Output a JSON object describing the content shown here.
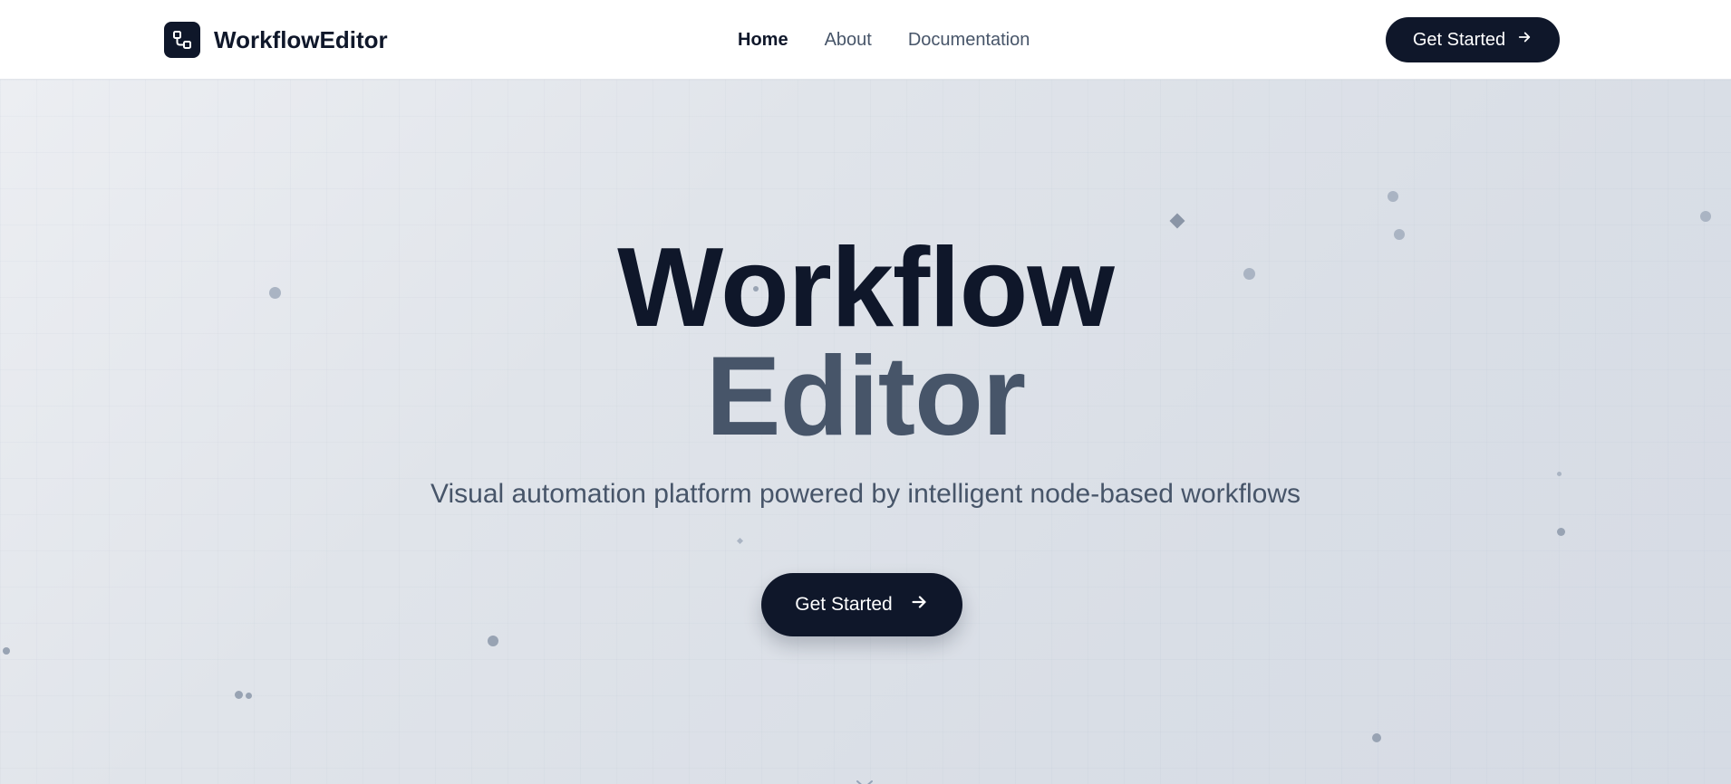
{
  "header": {
    "brand_name": "WorkflowEditor",
    "nav": [
      {
        "label": "Home",
        "active": true
      },
      {
        "label": "About",
        "active": false
      },
      {
        "label": "Documentation",
        "active": false
      }
    ],
    "cta_label": "Get Started"
  },
  "hero": {
    "title_line1": "Workflow",
    "title_line2": "Editor",
    "subtitle": "Visual automation platform powered by intelligent node-based workflows",
    "cta_label": "Get Started"
  },
  "icons": {
    "logo": "workflow-nodes-icon",
    "cta_arrow": "arrow-right-icon",
    "scroll": "chevron-down-icon"
  },
  "colors": {
    "primary": "#0f172a",
    "secondary_text": "#475569",
    "hero_background": "#dfe3e9",
    "particle": "#aab4c3"
  }
}
